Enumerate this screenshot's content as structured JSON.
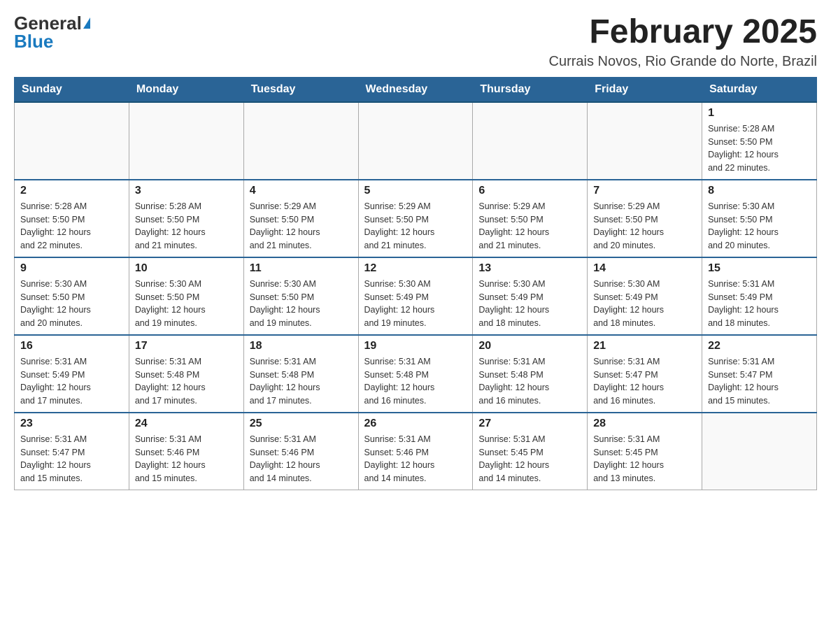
{
  "header": {
    "logo_general": "General",
    "logo_blue": "Blue",
    "month_title": "February 2025",
    "location": "Currais Novos, Rio Grande do Norte, Brazil"
  },
  "weekdays": [
    "Sunday",
    "Monday",
    "Tuesday",
    "Wednesday",
    "Thursday",
    "Friday",
    "Saturday"
  ],
  "weeks": [
    [
      {
        "day": "",
        "info": ""
      },
      {
        "day": "",
        "info": ""
      },
      {
        "day": "",
        "info": ""
      },
      {
        "day": "",
        "info": ""
      },
      {
        "day": "",
        "info": ""
      },
      {
        "day": "",
        "info": ""
      },
      {
        "day": "1",
        "info": "Sunrise: 5:28 AM\nSunset: 5:50 PM\nDaylight: 12 hours\nand 22 minutes."
      }
    ],
    [
      {
        "day": "2",
        "info": "Sunrise: 5:28 AM\nSunset: 5:50 PM\nDaylight: 12 hours\nand 22 minutes."
      },
      {
        "day": "3",
        "info": "Sunrise: 5:28 AM\nSunset: 5:50 PM\nDaylight: 12 hours\nand 21 minutes."
      },
      {
        "day": "4",
        "info": "Sunrise: 5:29 AM\nSunset: 5:50 PM\nDaylight: 12 hours\nand 21 minutes."
      },
      {
        "day": "5",
        "info": "Sunrise: 5:29 AM\nSunset: 5:50 PM\nDaylight: 12 hours\nand 21 minutes."
      },
      {
        "day": "6",
        "info": "Sunrise: 5:29 AM\nSunset: 5:50 PM\nDaylight: 12 hours\nand 21 minutes."
      },
      {
        "day": "7",
        "info": "Sunrise: 5:29 AM\nSunset: 5:50 PM\nDaylight: 12 hours\nand 20 minutes."
      },
      {
        "day": "8",
        "info": "Sunrise: 5:30 AM\nSunset: 5:50 PM\nDaylight: 12 hours\nand 20 minutes."
      }
    ],
    [
      {
        "day": "9",
        "info": "Sunrise: 5:30 AM\nSunset: 5:50 PM\nDaylight: 12 hours\nand 20 minutes."
      },
      {
        "day": "10",
        "info": "Sunrise: 5:30 AM\nSunset: 5:50 PM\nDaylight: 12 hours\nand 19 minutes."
      },
      {
        "day": "11",
        "info": "Sunrise: 5:30 AM\nSunset: 5:50 PM\nDaylight: 12 hours\nand 19 minutes."
      },
      {
        "day": "12",
        "info": "Sunrise: 5:30 AM\nSunset: 5:49 PM\nDaylight: 12 hours\nand 19 minutes."
      },
      {
        "day": "13",
        "info": "Sunrise: 5:30 AM\nSunset: 5:49 PM\nDaylight: 12 hours\nand 18 minutes."
      },
      {
        "day": "14",
        "info": "Sunrise: 5:30 AM\nSunset: 5:49 PM\nDaylight: 12 hours\nand 18 minutes."
      },
      {
        "day": "15",
        "info": "Sunrise: 5:31 AM\nSunset: 5:49 PM\nDaylight: 12 hours\nand 18 minutes."
      }
    ],
    [
      {
        "day": "16",
        "info": "Sunrise: 5:31 AM\nSunset: 5:49 PM\nDaylight: 12 hours\nand 17 minutes."
      },
      {
        "day": "17",
        "info": "Sunrise: 5:31 AM\nSunset: 5:48 PM\nDaylight: 12 hours\nand 17 minutes."
      },
      {
        "day": "18",
        "info": "Sunrise: 5:31 AM\nSunset: 5:48 PM\nDaylight: 12 hours\nand 17 minutes."
      },
      {
        "day": "19",
        "info": "Sunrise: 5:31 AM\nSunset: 5:48 PM\nDaylight: 12 hours\nand 16 minutes."
      },
      {
        "day": "20",
        "info": "Sunrise: 5:31 AM\nSunset: 5:48 PM\nDaylight: 12 hours\nand 16 minutes."
      },
      {
        "day": "21",
        "info": "Sunrise: 5:31 AM\nSunset: 5:47 PM\nDaylight: 12 hours\nand 16 minutes."
      },
      {
        "day": "22",
        "info": "Sunrise: 5:31 AM\nSunset: 5:47 PM\nDaylight: 12 hours\nand 15 minutes."
      }
    ],
    [
      {
        "day": "23",
        "info": "Sunrise: 5:31 AM\nSunset: 5:47 PM\nDaylight: 12 hours\nand 15 minutes."
      },
      {
        "day": "24",
        "info": "Sunrise: 5:31 AM\nSunset: 5:46 PM\nDaylight: 12 hours\nand 15 minutes."
      },
      {
        "day": "25",
        "info": "Sunrise: 5:31 AM\nSunset: 5:46 PM\nDaylight: 12 hours\nand 14 minutes."
      },
      {
        "day": "26",
        "info": "Sunrise: 5:31 AM\nSunset: 5:46 PM\nDaylight: 12 hours\nand 14 minutes."
      },
      {
        "day": "27",
        "info": "Sunrise: 5:31 AM\nSunset: 5:45 PM\nDaylight: 12 hours\nand 14 minutes."
      },
      {
        "day": "28",
        "info": "Sunrise: 5:31 AM\nSunset: 5:45 PM\nDaylight: 12 hours\nand 13 minutes."
      },
      {
        "day": "",
        "info": ""
      }
    ]
  ]
}
